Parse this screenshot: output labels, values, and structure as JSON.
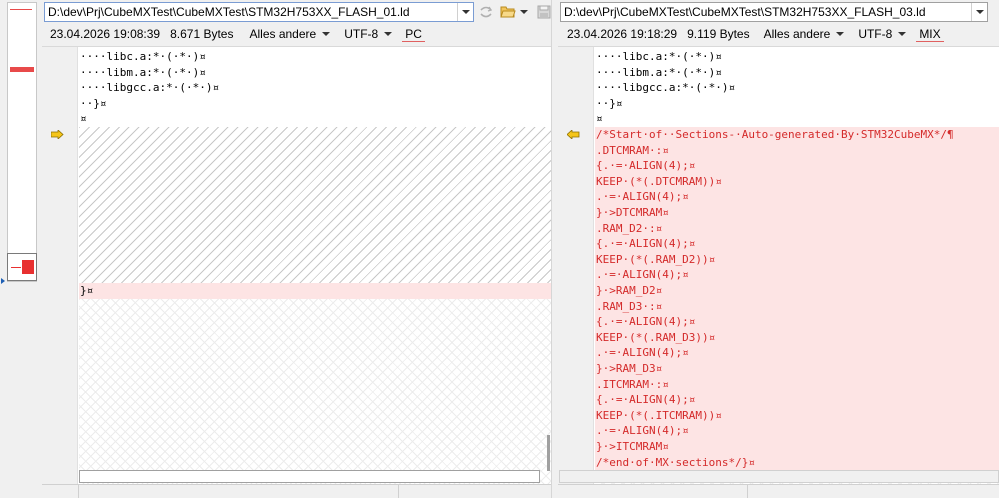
{
  "left": {
    "path": "D:\\dev\\Prj\\CubeMXTest\\CubeMXTest\\STM32H753XX_FLASH_01.ld",
    "date": "23.04.2026 19:08:39",
    "size": "8.671 Bytes",
    "filter": "Alles andere",
    "encoding": "UTF-8",
    "line_ending": "PC",
    "lines": [
      {
        "text": "····libc.a:*·(·*·)¤"
      },
      {
        "text": "····libm.a:*·(·*·)¤"
      },
      {
        "text": "····libgcc.a:*·(·*·)¤"
      },
      {
        "text": "··}¤"
      },
      {
        "text": "¤"
      }
    ],
    "after_gap_line": "}¤"
  },
  "right": {
    "path": "D:\\dev\\Prj\\CubeMXTest\\CubeMXTest\\STM32H753XX_FLASH_03.ld",
    "date": "23.04.2026 19:18:29",
    "size": "9.119 Bytes",
    "filter": "Alles andere",
    "encoding": "UTF-8",
    "line_ending": "MIX",
    "lines": [
      {
        "text": "····libc.a:*·(·*·)¤"
      },
      {
        "text": "····libm.a:*·(·*·)¤"
      },
      {
        "text": "····libgcc.a:*·(·*·)¤"
      },
      {
        "text": "··}¤"
      },
      {
        "text": "¤"
      }
    ],
    "added_lines": [
      "/*Start·of··Sections-·Auto-generated·By·STM32CubeMX*/¶",
      ".DTCMRAM·:¤",
      "{.·=·ALIGN(4);¤",
      "KEEP·(*(.DTCMRAM))¤",
      ".·=·ALIGN(4);¤",
      "}·>DTCMRAM¤",
      ".RAM_D2·:¤",
      "{.·=·ALIGN(4);¤",
      "KEEP·(*(.RAM_D2))¤",
      ".·=·ALIGN(4);¤",
      "}·>RAM_D2¤",
      ".RAM_D3·:¤",
      "{.·=·ALIGN(4);¤",
      "KEEP·(*(.RAM_D3))¤",
      ".·=·ALIGN(4);¤",
      "}·>RAM_D3¤",
      ".ITCMRAM·:¤",
      "{.·=·ALIGN(4);¤",
      "KEEP·(*(.ITCMRAM))¤",
      ".·=·ALIGN(4);¤",
      "}·>ITCMRAM¤",
      "/*end·of·MX·sections*/}¤"
    ]
  },
  "icons": {
    "sync": "sync-arrows-icon",
    "open": "open-folder-icon",
    "save": "save-disk-icon",
    "diff_marker": "diff-arrow-icon"
  },
  "colors": {
    "added_bg": "#fde4e4",
    "added_text": "#d42a2a",
    "marker": "#f5c518",
    "accent": "#7a9cd3"
  }
}
